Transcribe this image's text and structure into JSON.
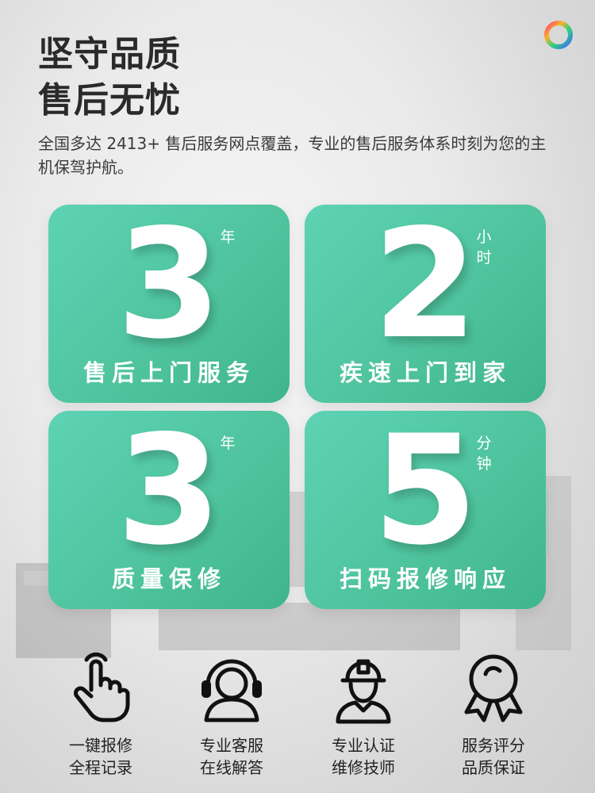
{
  "brand": {
    "logo_icon": "ring-logo-icon",
    "accent": "#4fc49e"
  },
  "header": {
    "title_line1": "坚守品质",
    "title_line2": "售后无忧",
    "description": "全国多达 2413+ 售后服务网点覆盖，专业的售后服务体系时刻为您的主机保驾护航。"
  },
  "cards": [
    {
      "number": "3",
      "unit": "年",
      "label": "售后上门服务"
    },
    {
      "number": "2",
      "unit": "小时",
      "label": "疾速上门到家"
    },
    {
      "number": "3",
      "unit": "年",
      "label": "质量保修"
    },
    {
      "number": "5",
      "unit": "分钟",
      "label": "扫码报修响应"
    }
  ],
  "features": [
    {
      "icon": "tap-hand-icon",
      "line1": "一键报修",
      "line2": "全程记录"
    },
    {
      "icon": "headset-support-icon",
      "line1": "专业客服",
      "line2": "在线解答"
    },
    {
      "icon": "technician-helmet-icon",
      "line1": "专业认证",
      "line2": "维修技师"
    },
    {
      "icon": "award-medal-icon",
      "line1": "服务评分",
      "line2": "品质保证"
    }
  ]
}
